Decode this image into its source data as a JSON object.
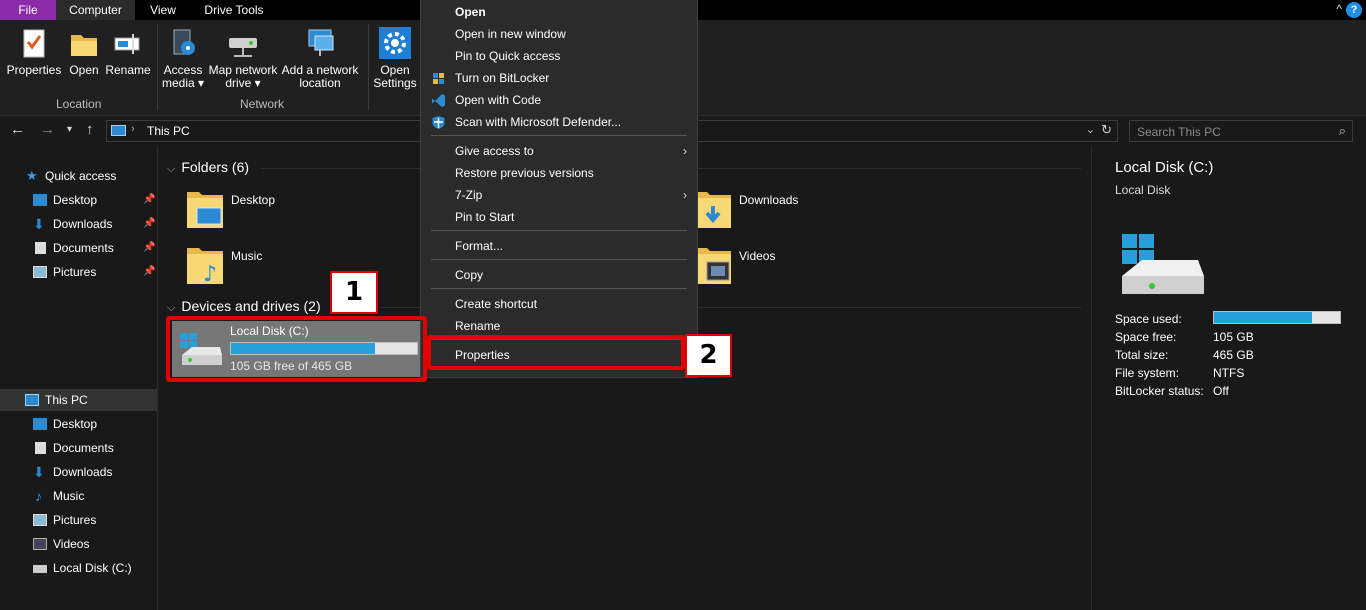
{
  "tabs": [
    "File",
    "Computer",
    "View",
    "Drive Tools"
  ],
  "ribbon": {
    "location_group": "Location",
    "network_group": "Network",
    "buttons": {
      "properties": "Properties",
      "open": "Open",
      "rename": "Rename",
      "access_media_1": "Access",
      "access_media_2": "media ▾",
      "map_drive_1": "Map network",
      "map_drive_2": "drive ▾",
      "add_location_1": "Add a network",
      "add_location_2": "location",
      "open_settings_1": "Open",
      "open_settings_2": "Settings"
    },
    "help_glyph": "?",
    "collapse_glyph": "^"
  },
  "address": {
    "path": "This PC",
    "search_placeholder": "Search This PC"
  },
  "nav": {
    "quick_access": "Quick access",
    "quick_items": [
      "Desktop",
      "Downloads",
      "Documents",
      "Pictures"
    ],
    "this_pc": "This PC",
    "pc_items": [
      "Desktop",
      "Documents",
      "Downloads",
      "Music",
      "Pictures",
      "Videos",
      "Local Disk (C:)"
    ]
  },
  "content": {
    "folders_header": "Folders (6)",
    "folders": [
      "Desktop",
      "Downloads",
      "Music",
      "Videos"
    ],
    "devices_header": "Devices and drives (2)",
    "drive": {
      "name": "Local Disk (C:)",
      "status": "105 GB free of 465 GB",
      "used_fraction": 0.774
    }
  },
  "menu": {
    "items": [
      "Open",
      "Open in new window",
      "Pin to Quick access",
      "Turn on BitLocker",
      "Open with Code",
      "Scan with Microsoft Defender...",
      "Give access to",
      "Restore previous versions",
      "7-Zip",
      "Pin to Start",
      "Format...",
      "Copy",
      "Create shortcut",
      "Rename",
      "Properties"
    ]
  },
  "details": {
    "title": "Local Disk (C:)",
    "subtitle": "Local Disk",
    "labels": [
      "Space used:",
      "Space free:",
      "Total size:",
      "File system:",
      "BitLocker status:"
    ],
    "values": [
      "",
      "105 GB",
      "465 GB",
      "NTFS",
      "Off"
    ],
    "used_fraction": 0.774
  },
  "callouts": [
    "1",
    "2"
  ],
  "colors": {
    "accent": "#26a0da",
    "highlight": "#e20000",
    "file_tab": "#8a2ba8"
  }
}
